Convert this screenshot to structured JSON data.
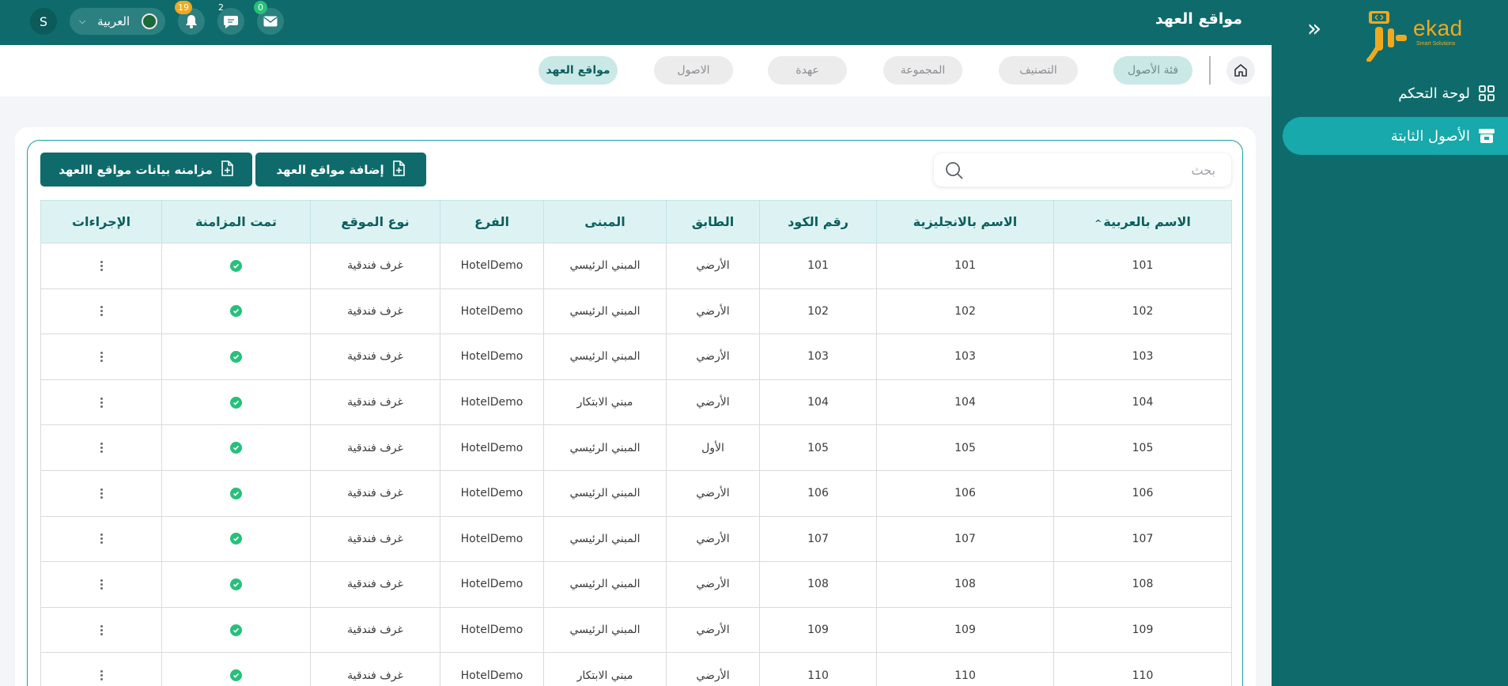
{
  "logo": {
    "text": "ekad",
    "subtitle": "Smart Solutions"
  },
  "sidebar": {
    "items": [
      {
        "label": "لوحة التحكم",
        "icon": "grid-icon",
        "active": false
      },
      {
        "label": "الأصول الثابتة",
        "icon": "store-icon",
        "active": true
      }
    ]
  },
  "header": {
    "title": "مواقع العهد",
    "mail_count": "0",
    "chat_count": "2",
    "notification_count": "19",
    "language": "العربية",
    "user_initial": "S"
  },
  "tabs": [
    {
      "label": "فئة الأصول"
    },
    {
      "label": "التصنيف"
    },
    {
      "label": "المجموعة"
    },
    {
      "label": "عهدة"
    },
    {
      "label": "الاصول"
    },
    {
      "label": "مواقع العهد"
    }
  ],
  "search": {
    "placeholder": "بحث",
    "value": ""
  },
  "actions": {
    "add_label": "إضافة مواقع العهد",
    "sync_label": "مزامنه بيانات مواقع االعهد"
  },
  "table": {
    "columns": [
      "الاسم بالعربية",
      "الاسم بالانجليزية",
      "رقم الكود",
      "الطابق",
      "المبنى",
      "الفرع",
      "نوع الموقع",
      "تمت المزامنة",
      "الإجراءات"
    ],
    "rows": [
      [
        "101",
        "101",
        "101",
        "الأرضي",
        "المبني الرئيسي",
        "HotelDemo",
        "غرف فندقية"
      ],
      [
        "102",
        "102",
        "102",
        "الأرضي",
        "المبني الرئيسي",
        "HotelDemo",
        "غرف فندقية"
      ],
      [
        "103",
        "103",
        "103",
        "الأرضي",
        "المبني الرئيسي",
        "HotelDemo",
        "غرف فندقية"
      ],
      [
        "104",
        "104",
        "104",
        "الأرضي",
        "مبني الابتكار",
        "HotelDemo",
        "غرف فندقية"
      ],
      [
        "105",
        "105",
        "105",
        "الأول",
        "المبني الرئيسي",
        "HotelDemo",
        "غرف فندقية"
      ],
      [
        "106",
        "106",
        "106",
        "الأرضي",
        "المبني الرئيسي",
        "HotelDemo",
        "غرف فندقية"
      ],
      [
        "107",
        "107",
        "107",
        "الأرضي",
        "المبني الرئيسي",
        "HotelDemo",
        "غرف فندقية"
      ],
      [
        "108",
        "108",
        "108",
        "الأرضي",
        "المبني الرئيسي",
        "HotelDemo",
        "غرف فندقية"
      ],
      [
        "109",
        "109",
        "109",
        "الأرضي",
        "المبني الرئيسي",
        "HotelDemo",
        "غرف فندقية"
      ],
      [
        "110",
        "110",
        "110",
        "الأرضي",
        "مبني الابتكار",
        "HotelDemo",
        "غرف فندقية"
      ]
    ]
  },
  "colors": {
    "primary": "#0f6b6b",
    "accent": "#17a9ac",
    "logo": "#f0a91e",
    "header_bg": "#ddf3f3",
    "success": "#27c07a"
  }
}
